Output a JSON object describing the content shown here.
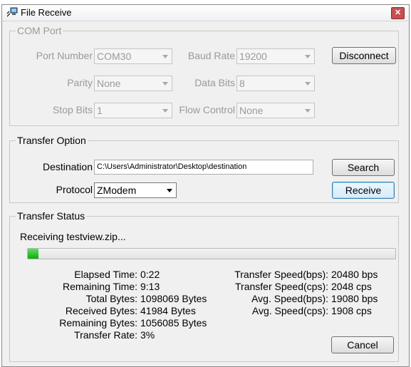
{
  "window": {
    "title": "File Receive",
    "title_icon": "computer-transfer-icon",
    "close_glyph": "✕"
  },
  "com_port": {
    "legend": "COM Port",
    "port_number_label": "Port Number",
    "port_number_value": "COM30",
    "baud_rate_label": "Baud Rate",
    "baud_rate_value": "19200",
    "parity_label": "Parity",
    "parity_value": "None",
    "data_bits_label": "Data Bits",
    "data_bits_value": "8",
    "stop_bits_label": "Stop Bits",
    "stop_bits_value": "1",
    "flow_control_label": "Flow Control",
    "flow_control_value": "None",
    "disconnect_label": "Disconnect"
  },
  "transfer_option": {
    "legend": "Transfer Option",
    "destination_label": "Destination",
    "destination_value": "C:\\Users\\Administrator\\Desktop\\destination",
    "search_label": "Search",
    "protocol_label": "Protocol",
    "protocol_value": "ZModem",
    "receive_label": "Receive"
  },
  "transfer_status": {
    "legend": "Transfer Status",
    "status_text": "Receiving testview.zip...",
    "progress_percent": 3,
    "elapsed_time_label": "Elapsed Time:",
    "elapsed_time_value": "0:22",
    "remaining_time_label": "Remaining Time:",
    "remaining_time_value": "9:13",
    "total_bytes_label": "Total Bytes:",
    "total_bytes_value": "1098069 Bytes",
    "received_bytes_label": "Received Bytes:",
    "received_bytes_value": "41984 Bytes",
    "remaining_bytes_label": "Remaining Bytes:",
    "remaining_bytes_value": "1056085 Bytes",
    "transfer_rate_label": "Transfer Rate:",
    "transfer_rate_value": "3%",
    "speed_bps_label": "Transfer Speed(bps):",
    "speed_bps_value": "20480 bps",
    "speed_cps_label": "Transfer Speed(cps):",
    "speed_cps_value": "2048 cps",
    "avg_bps_label": "Avg. Speed(bps):",
    "avg_bps_value": "19080 bps",
    "avg_cps_label": "Avg. Speed(cps):",
    "avg_cps_value": "1908 cps",
    "cancel_label": "Cancel"
  }
}
